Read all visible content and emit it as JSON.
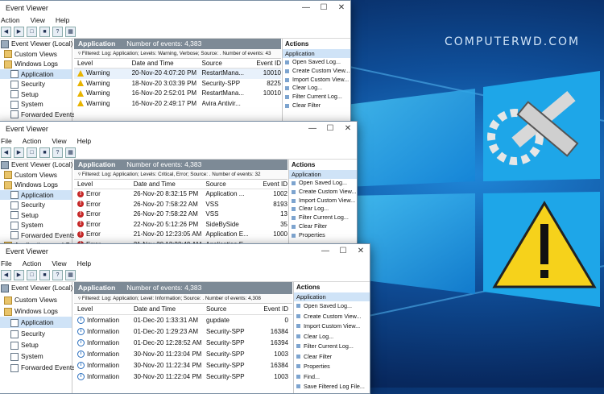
{
  "brand": "COMPUTERWD.COM",
  "colors": {
    "accent": "#0f4f9a",
    "header": "#7d8a96",
    "selection": "#cfe3f7",
    "warning": "#e8b400",
    "error": "#c62828"
  },
  "windows": [
    {
      "title": "Event Viewer",
      "menu": [
        "Action",
        "View",
        "Help"
      ],
      "tree": [
        "Event Viewer (Local)",
        "Custom Views",
        "Windows Logs",
        "Application",
        "Security",
        "Setup",
        "System",
        "Forwarded Events"
      ],
      "header": {
        "title": "Application",
        "count": "Number of events: 4,383"
      },
      "filter": "Filtered: Log: Application; Levels: Warning, Verbose; Source: . Number of events: 43",
      "columns": [
        "Level",
        "Date and Time",
        "Source",
        "Event ID"
      ],
      "rows": [
        {
          "icon": "warning-icon",
          "level": "Warning",
          "date": "20-Nov-20 4:07:20 PM",
          "source": "RestartMana...",
          "id": "10010"
        },
        {
          "icon": "warning-icon",
          "level": "Warning",
          "date": "18-Nov-20 3:03:39 PM",
          "source": "Security-SPP",
          "id": "8225"
        },
        {
          "icon": "warning-icon",
          "level": "Warning",
          "date": "16-Nov-20 2:52:01 PM",
          "source": "RestartMana...",
          "id": "10010"
        },
        {
          "icon": "warning-icon",
          "level": "Warning",
          "date": "16-Nov-20 2:49:17 PM",
          "source": "Avira Antivir...",
          "id": ""
        }
      ],
      "actions_title": "Actions",
      "actions_section": "Application",
      "actions": [
        "Open Saved Log...",
        "Create Custom View...",
        "Import Custom View...",
        "Clear Log...",
        "Filter Current Log...",
        "Clear Filter"
      ]
    },
    {
      "title": "Event Viewer",
      "menu": [
        "File",
        "Action",
        "View",
        "Help"
      ],
      "tree": [
        "Event Viewer (Local)",
        "Custom Views",
        "Windows Logs",
        "Application",
        "Security",
        "Setup",
        "System",
        "Forwarded Events",
        "Applications and Serv"
      ],
      "header": {
        "title": "Application",
        "count": "Number of events: 4,383"
      },
      "filter": "Filtered: Log: Application; Levels: Critical, Error; Source: . Number of events: 32",
      "columns": [
        "Level",
        "Date and Time",
        "Source",
        "Event ID"
      ],
      "rows": [
        {
          "icon": "error-icon",
          "level": "Error",
          "date": "26-Nov-20 8:32:15 PM",
          "source": "Application ...",
          "id": "1002"
        },
        {
          "icon": "error-icon",
          "level": "Error",
          "date": "26-Nov-20 7:58:22 AM",
          "source": "VSS",
          "id": "8193"
        },
        {
          "icon": "error-icon",
          "level": "Error",
          "date": "26-Nov-20 7:58:22 AM",
          "source": "VSS",
          "id": "13"
        },
        {
          "icon": "error-icon",
          "level": "Error",
          "date": "22-Nov-20 5:12:26 PM",
          "source": "SideBySide",
          "id": "35"
        },
        {
          "icon": "error-icon",
          "level": "Error",
          "date": "21-Nov-20 12:23:05 AM",
          "source": "Application E...",
          "id": "1000"
        },
        {
          "icon": "error-icon",
          "level": "Error",
          "date": "21-Nov-20 12:22:49 AM",
          "source": "Application E...",
          "id": ""
        }
      ],
      "actions_title": "Actions",
      "actions_section": "Application",
      "actions": [
        "Open Saved Log...",
        "Create Custom View...",
        "Import Custom View...",
        "Clear Log...",
        "Filter Current Log...",
        "Clear Filter",
        "Properties"
      ]
    },
    {
      "title": "Event Viewer",
      "menu": [
        "File",
        "Action",
        "View",
        "Help"
      ],
      "tree": [
        "Event Viewer (Local)",
        "Custom Views",
        "Windows Logs",
        "Application",
        "Security",
        "Setup",
        "System",
        "Forwarded Events"
      ],
      "header": {
        "title": "Application",
        "count": "Number of events: 4,383"
      },
      "filter": "Filtered: Log: Application; Level: Information; Source: . Number of events: 4,308",
      "columns": [
        "Level",
        "Date and Time",
        "Source",
        "Event ID"
      ],
      "rows": [
        {
          "icon": "information-icon",
          "level": "Information",
          "date": "01-Dec-20 1:33:31 AM",
          "source": "gupdate",
          "id": "0"
        },
        {
          "icon": "information-icon",
          "level": "Information",
          "date": "01-Dec-20 1:29:23 AM",
          "source": "Security-SPP",
          "id": "16384"
        },
        {
          "icon": "information-icon",
          "level": "Information",
          "date": "01-Dec-20 12:28:52 AM",
          "source": "Security-SPP",
          "id": "16394"
        },
        {
          "icon": "information-icon",
          "level": "Information",
          "date": "30-Nov-20 11:23:04 PM",
          "source": "Security-SPP",
          "id": "1003"
        },
        {
          "icon": "information-icon",
          "level": "Information",
          "date": "30-Nov-20 11:22:34 PM",
          "source": "Security-SPP",
          "id": "16384"
        },
        {
          "icon": "information-icon",
          "level": "Information",
          "date": "30-Nov-20 11:22:04 PM",
          "source": "Security-SPP",
          "id": "1003"
        }
      ],
      "actions_title": "Actions",
      "actions_section": "Application",
      "actions": [
        "Open Saved Log...",
        "Create Custom View...",
        "Import Custom View...",
        "Clear Log...",
        "Filter Current Log...",
        "Clear Filter",
        "Properties",
        "Find...",
        "Save Filtered Log File..."
      ]
    }
  ]
}
